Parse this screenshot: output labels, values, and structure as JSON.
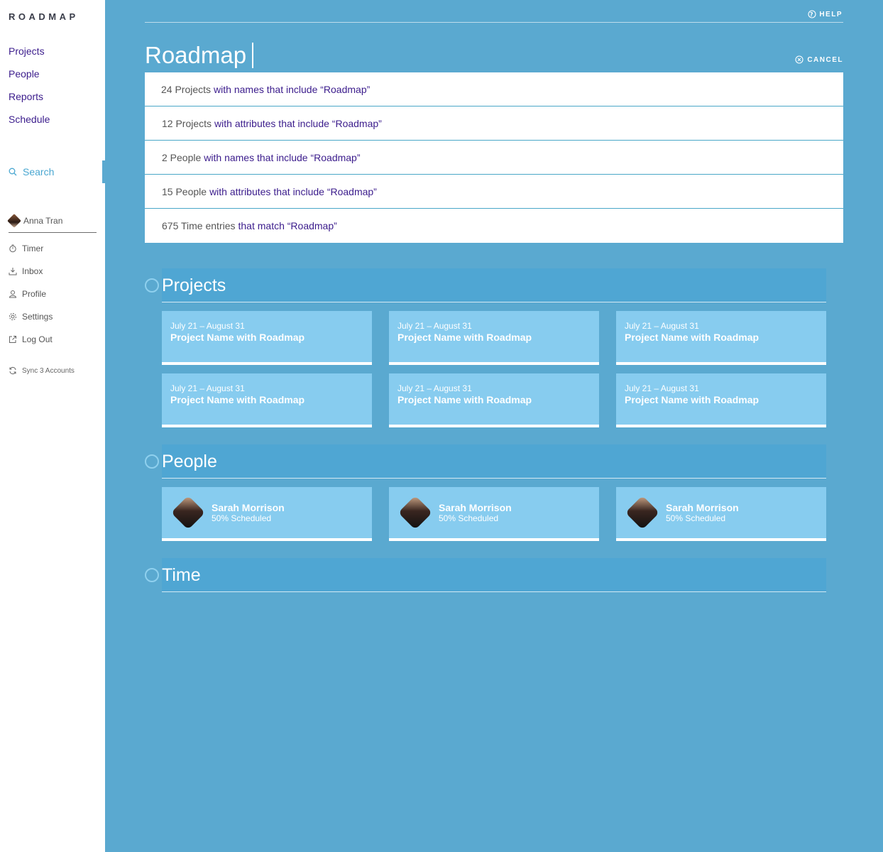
{
  "app": {
    "logo": "ROADMAP"
  },
  "sidebar": {
    "nav": [
      "Projects",
      "People",
      "Reports",
      "Schedule"
    ],
    "search_label": "Search",
    "user_name": "Anna Tran",
    "menu": [
      {
        "label": "Timer",
        "icon": "timer-icon"
      },
      {
        "label": "Inbox",
        "icon": "inbox-icon"
      },
      {
        "label": "Profile",
        "icon": "profile-icon"
      },
      {
        "label": "Settings",
        "icon": "settings-icon"
      },
      {
        "label": "Log Out",
        "icon": "logout-icon"
      }
    ],
    "sync_label": "Sync 3 Accounts"
  },
  "header": {
    "help_label": "HELP",
    "cancel_label": "CANCEL",
    "query": "Roadmap"
  },
  "results": [
    {
      "count": "24 Projects",
      "desc": "with names that include “Roadmap”"
    },
    {
      "count": "12 Projects",
      "desc": "with attributes that include “Roadmap”"
    },
    {
      "count": "2 People",
      "desc": "with names that include “Roadmap”"
    },
    {
      "count": "15 People",
      "desc": "with attributes that include “Roadmap”"
    },
    {
      "count": "675 Time entries",
      "desc": "that match “Roadmap”"
    }
  ],
  "sections": {
    "projects": {
      "title": "Projects",
      "items": [
        {
          "date": "July 21 – August 31",
          "name": "Project Name with Roadmap"
        },
        {
          "date": "July 21 – August 31",
          "name": "Project Name with Roadmap"
        },
        {
          "date": "July 21 – August 31",
          "name": "Project Name with Roadmap"
        },
        {
          "date": "July 21 – August 31",
          "name": "Project Name with Roadmap"
        },
        {
          "date": "July 21 – August 31",
          "name": "Project Name with Roadmap"
        },
        {
          "date": "July 21 – August 31",
          "name": "Project Name with Roadmap"
        }
      ]
    },
    "people": {
      "title": "People",
      "items": [
        {
          "name": "Sarah Morrison",
          "status": "50% Scheduled"
        },
        {
          "name": "Sarah Morrison",
          "status": "50% Scheduled"
        },
        {
          "name": "Sarah Morrison",
          "status": "50% Scheduled"
        }
      ]
    },
    "time": {
      "title": "Time"
    }
  },
  "colors": {
    "background": "#5aa9d0",
    "card": "#87ccef",
    "link": "#3b1c8c",
    "accent": "#4aa7d1"
  }
}
